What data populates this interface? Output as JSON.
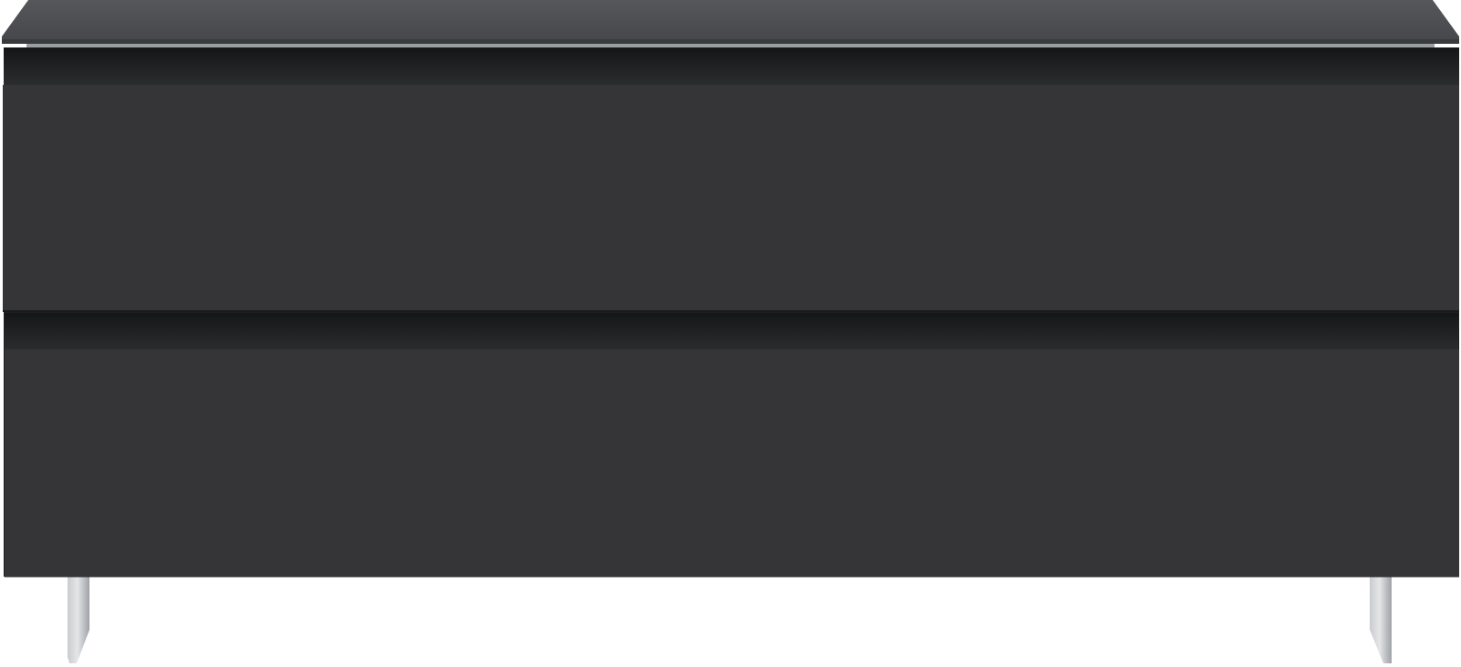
{
  "product": {
    "kind": "sideboard",
    "drawer_count": 2,
    "leg_count": 2
  },
  "colors": {
    "background": "#ffffff",
    "glass_top": "#4f5054",
    "glass_top_edge": "#3a3b3e",
    "aluminium_strip": "#9a9da1",
    "body_shadow": "#1e1f21",
    "drawer_front": "#353537",
    "drawer_edge": "#2a2a2c",
    "leg_light": "#d3d5d8",
    "leg_dark": "#a8abaf"
  }
}
